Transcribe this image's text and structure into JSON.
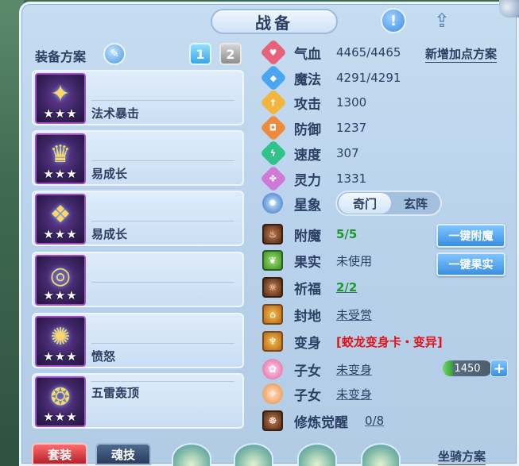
{
  "window": {
    "title": "战备"
  },
  "equipment": {
    "section_label": "装备方案",
    "slots": [
      "1",
      "2"
    ],
    "stars": "★★★",
    "items": [
      {
        "name": "法术暴击"
      },
      {
        "name": "易成长"
      },
      {
        "name": "易成长"
      },
      {
        "name": ""
      },
      {
        "name": "愤怒"
      },
      {
        "name": "五雷轰顶"
      }
    ]
  },
  "stats": {
    "new_plan_label": "新增加点方案",
    "rows": [
      {
        "name": "气血",
        "value": "4465/4465",
        "icon": "heart-icon",
        "color": "#e8617a"
      },
      {
        "name": "魔法",
        "value": "4291/4291",
        "icon": "mana-icon",
        "color": "#4aa6f0"
      },
      {
        "name": "攻击",
        "value": "1300",
        "icon": "sword-icon",
        "color": "#f3b53a"
      },
      {
        "name": "防御",
        "value": "1237",
        "icon": "shield-icon",
        "color": "#f08a3c"
      },
      {
        "name": "速度",
        "value": "307",
        "icon": "speed-icon",
        "color": "#2fc38b"
      },
      {
        "name": "灵力",
        "value": "1331",
        "icon": "spirit-icon",
        "color": "#d07ad8"
      }
    ]
  },
  "star_sign": {
    "label": "星象",
    "options": [
      "奇门",
      "玄阵"
    ],
    "selected": "奇门"
  },
  "extras": [
    {
      "name": "附魔",
      "value": "5/5",
      "icon": "enchant-icon"
    },
    {
      "name": "果实",
      "value": "未使用",
      "icon": "fruit-icon"
    },
    {
      "name": "祈福",
      "value": "2/2",
      "icon": "blessing-icon"
    },
    {
      "name": "封地",
      "value": "未受赏",
      "icon": "fief-icon"
    },
    {
      "name": "变身",
      "value": "[蛟龙变身卡・变异]",
      "icon": "transform-icon"
    },
    {
      "name": "子女",
      "value": "未变身",
      "icon": "child-icon"
    },
    {
      "name": "子女",
      "value": "未变身",
      "icon": "child-icon"
    },
    {
      "name": "修炼觉醒",
      "value": "0/8",
      "icon": "cultivation-icon"
    }
  ],
  "buttons": {
    "one_click_enchant": "一键附魔",
    "one_click_fruit": "一键果实"
  },
  "mount": {
    "value": "1450",
    "plus": "+"
  },
  "bottom": {
    "tabs": [
      "套装",
      "魂技"
    ],
    "mount_plan": "坐骑方案"
  },
  "colors": {
    "panel": "#bcd5ee",
    "accent_blue": "#3a8fe0",
    "green_text": "#1b9a2a",
    "red_text": "#e0141a"
  }
}
